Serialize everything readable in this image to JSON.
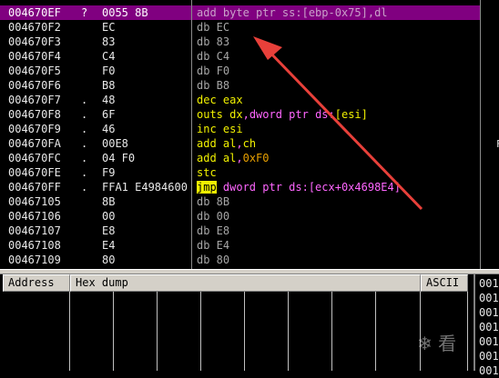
{
  "disasm": {
    "rows": [
      {
        "addr": "004670EF",
        "mark": "?",
        "hex": "0055 8B",
        "dis": [
          {
            "t": "add byte ptr ss:[ebp-0x75],dl",
            "c": "plain"
          }
        ],
        "selected": true
      },
      {
        "addr": "004670F2",
        "mark": "",
        "hex": "EC",
        "dis": [
          {
            "t": "db EC",
            "c": "mut"
          }
        ]
      },
      {
        "addr": "004670F3",
        "mark": "",
        "hex": "83",
        "dis": [
          {
            "t": "db 83",
            "c": "mut"
          }
        ]
      },
      {
        "addr": "004670F4",
        "mark": "",
        "hex": "C4",
        "dis": [
          {
            "t": "db C4",
            "c": "mut"
          }
        ]
      },
      {
        "addr": "004670F5",
        "mark": "",
        "hex": "F0",
        "dis": [
          {
            "t": "db F0",
            "c": "mut"
          }
        ]
      },
      {
        "addr": "004670F6",
        "mark": "",
        "hex": "B8",
        "dis": [
          {
            "t": "db B8",
            "c": "mut"
          }
        ]
      },
      {
        "addr": "004670F7",
        "mark": ".",
        "hex": "48",
        "dis": [
          {
            "t": "dec",
            "c": "cmd"
          },
          {
            "t": " ",
            "c": "mut"
          },
          {
            "t": "eax",
            "c": "cmd"
          }
        ]
      },
      {
        "addr": "004670F8",
        "mark": ".",
        "hex": "6F",
        "dis": [
          {
            "t": "outs",
            "c": "cmd"
          },
          {
            "t": " ",
            "c": "mut"
          },
          {
            "t": "dx",
            "c": "cmd"
          },
          {
            "t": ",dword ptr ds:",
            "c": "arg"
          },
          {
            "t": "[esi]",
            "c": "cmd"
          }
        ]
      },
      {
        "addr": "004670F9",
        "mark": ".",
        "hex": "46",
        "dis": [
          {
            "t": "inc",
            "c": "cmd"
          },
          {
            "t": " ",
            "c": "mut"
          },
          {
            "t": "esi",
            "c": "cmd"
          }
        ]
      },
      {
        "addr": "004670FA",
        "mark": ".",
        "hex": "00E8",
        "dis": [
          {
            "t": "add",
            "c": "cmd"
          },
          {
            "t": " ",
            "c": "mut"
          },
          {
            "t": "al",
            "c": "cmd"
          },
          {
            "t": ",",
            "c": "arg"
          },
          {
            "t": "ch",
            "c": "cmd"
          }
        ]
      },
      {
        "addr": "004670FC",
        "mark": ".",
        "hex": "04 F0",
        "dis": [
          {
            "t": "add",
            "c": "cmd"
          },
          {
            "t": " ",
            "c": "mut"
          },
          {
            "t": "al",
            "c": "cmd"
          },
          {
            "t": ",",
            "c": "arg"
          },
          {
            "t": "0xF0",
            "c": "num"
          }
        ]
      },
      {
        "addr": "004670FE",
        "mark": ".",
        "hex": "F9",
        "dis": [
          {
            "t": "stc",
            "c": "cmd"
          }
        ]
      },
      {
        "addr": "004670FF",
        "mark": ".",
        "hex": "FFA1 E4984600",
        "dis": [
          {
            "t": "jmp",
            "c": "jmp"
          },
          {
            "t": " dword ptr ds:[ecx+0x4698E4]",
            "c": "jarg"
          }
        ]
      },
      {
        "addr": "00467105",
        "mark": "",
        "hex": "8B",
        "dis": [
          {
            "t": "db 8B",
            "c": "mut"
          }
        ]
      },
      {
        "addr": "00467106",
        "mark": "",
        "hex": "00",
        "dis": [
          {
            "t": "db 00",
            "c": "mut"
          }
        ]
      },
      {
        "addr": "00467107",
        "mark": "",
        "hex": "E8",
        "dis": [
          {
            "t": "db E8",
            "c": "mut"
          }
        ]
      },
      {
        "addr": "00467108",
        "mark": "",
        "hex": "E4",
        "dis": [
          {
            "t": "db E4",
            "c": "mut"
          }
        ]
      },
      {
        "addr": "00467109",
        "mark": "",
        "hex": "80",
        "dis": [
          {
            "t": "db 80",
            "c": "mut"
          }
        ]
      }
    ]
  },
  "right_strip": {
    "chars": [
      {
        "t": "1",
        "row": 8
      },
      {
        "t": "F",
        "row": 9
      }
    ]
  },
  "dump": {
    "headers": {
      "address": "Address",
      "hex": "Hex dump",
      "ascii": "ASCII"
    }
  },
  "stack": {
    "rows": [
      "001",
      "001",
      "001",
      "001",
      "001",
      "001",
      "001"
    ]
  },
  "watermark": {
    "text": "❄ 看"
  },
  "colors": {
    "selected_bg": "#800080",
    "accent_arrow": "#e8403a",
    "cmd": "#f0f000",
    "arg": "#ff66ff",
    "num": "#e8a000"
  }
}
